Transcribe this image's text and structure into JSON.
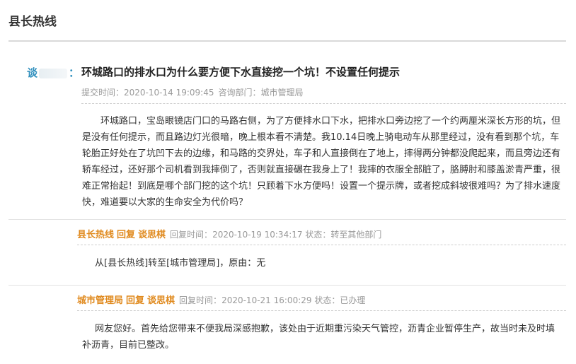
{
  "header": {
    "title": "县长热线"
  },
  "question": {
    "user_prefix": "谈",
    "user_suffix": "：",
    "title": "环城路口的排水口为什么要方便下水直接挖一个坑！不设置任何提示",
    "submit_label": "提交时间：",
    "submit_time": "2020-10-14 19:09:45",
    "dept_label": "咨询部门：",
    "dept": "城市管理局",
    "body": "环城路口，宝岛眼镜店门口的马路右侧，为了方便排水口下水，把排水口旁边挖了一个约两厘米深长方形的坑，但是没有任何提示，而且路边灯光很暗，晚上根本看不清楚。我10.14日晚上骑电动车从那里经过，没有看到那个坑，车轮胎正好处在了坑凹下去的边缘，和马路的交界处，车子和人直接倒在了地上，摔得两分钟都没爬起来，而且旁边还有轿车经过，还好那个司机看到我摔倒了，否则就直接碾在我身上了！我摔的衣服全部脏了，胳膊肘和膝盖淤青严重，很难正常抬起！到底是哪个部门挖的这个坑！只顾着下水方便吗！设置一个提示牌，或者挖成斜坡很难吗？为了排水速度快，难道要以大家的生命安全为代价吗？"
  },
  "replies": [
    {
      "org": "县长热线",
      "keyword": "回复",
      "to": "谈思棋",
      "time_label": "回复时间：",
      "time": "2020-10-19 10:34:17",
      "status_label": "状态：",
      "status": "转至其他部门",
      "body": "从[县长热线]转至[城市管理局]，原由：无"
    },
    {
      "org": "城市管理局",
      "keyword": "回复",
      "to": "谈思棋",
      "time_label": "回复时间：",
      "time": "2020-10-21 16:00:29",
      "status_label": "状态：",
      "status": "已办理",
      "body": "网友您好。首先给您带来不便我局深感抱歉，该处由于近期重污染天气管控，沥青企业暂停生产，故当时未及时填补沥青，目前已整改。"
    }
  ]
}
